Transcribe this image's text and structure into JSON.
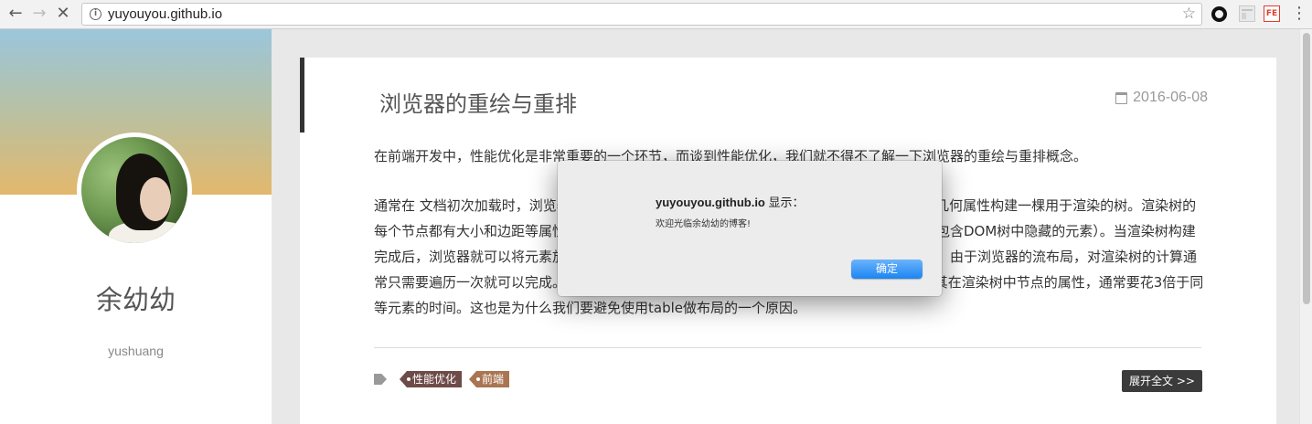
{
  "browser": {
    "url": "yuyouyou.github.io",
    "back_glyph": "←",
    "forward_glyph": "→",
    "stop_glyph": "✕",
    "star_glyph": "☆",
    "menu_glyph": "⋮",
    "extension_fe_label": "FE"
  },
  "sidebar": {
    "author_name": "余幼幼",
    "username": "yushuang"
  },
  "post": {
    "title": "浏览器的重绘与重排",
    "date": "2016-06-08",
    "paragraph1": "在前端开发中，性能优化是非常重要的一个环节，而谈到性能优化，我们就不得不了解一下浏览器的重绘与重排概念。",
    "paragraph2": "通常在 文档初次加载时，浏览器引擎会解析HTML文档来构建DOM树，之后根据DOM元素的几何属性构建一棵用于渲染的树。渲染树的每个节点都有大小和边距等属性，类似于盒子模型（由于隐藏元素不需要显示，渲染树中并不包含DOM树中隐藏的元素）。当渲染树构建完成后，浏览器就可以将元素放置到正确的位置了，再根据渲染树节点的样式属性绘制出页面。由于浏览器的流布局，对渲染树的计算通常只需要遍历一次就可以完成。但table及其内部元素除外，它可能需要多次 计算才能确定好其在渲染树中节点的属性，通常要花3倍于同等元素的时间。这也是为什么我们要避免使用table做布局的一个原因。",
    "tags": [
      {
        "label": "性能优化",
        "color": "#6e4b48"
      },
      {
        "label": "前端",
        "color": "#a97552"
      }
    ],
    "expand_label": "展开全文 >>"
  },
  "dialog": {
    "origin": "yuyouyou.github.io",
    "title_suffix": " 显示：",
    "message": "欢迎光临余幼幼的博客!",
    "ok_label": "确定"
  }
}
